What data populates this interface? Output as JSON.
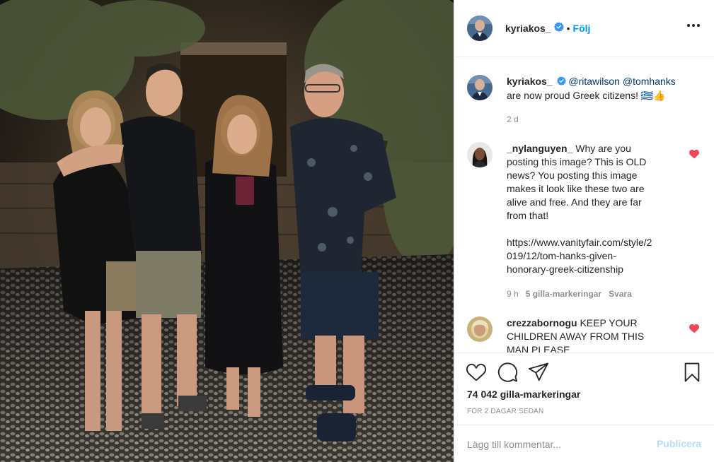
{
  "post": {
    "username": "kyriakos_",
    "follow_label": "Följ",
    "dot": "•"
  },
  "caption": {
    "username": "kyriakos_",
    "mention1": "@ritawilson",
    "mention2": "@tomhanks",
    "text": "are now proud Greek citizens! 🇬🇷👍",
    "flag_text": "GR",
    "time": "2 d"
  },
  "comments": [
    {
      "username": "_nylanguyen_",
      "text_lines": [
        "Why are you",
        "posting this image? This is OLD",
        "news? You posting this image",
        "makes it look like these two are",
        "alive and free. And they are far",
        "from that!"
      ],
      "link_lines": [
        "https://www.vanityfair.com/style/2",
        "019/12/tom-hanks-given-",
        "honorary-greek-citizenship"
      ],
      "time": "9 h",
      "likes_label": "5 gilla-markeringar",
      "reply_label": "Svara"
    },
    {
      "username": "crezzabornogu",
      "text_lines": [
        "KEEP YOUR",
        "CHILDREN AWAY FROM THIS",
        "MAN PLEASE"
      ]
    }
  ],
  "stats": {
    "likes_count": "74 042",
    "likes_label": "gilla-markeringar",
    "date": "FÖR 2 DAGAR SEDAN"
  },
  "add_comment": {
    "placeholder": "Lägg till kommentar...",
    "publish_label": "Publicera"
  },
  "colors": {
    "accent": "#0095f6",
    "link": "#00376b",
    "heart": "#ed4956",
    "muted": "#8e8e8e",
    "publish_disabled": "#b2dffc"
  },
  "icons": [
    "verified-badge-icon",
    "more-options-icon",
    "heart-icon",
    "comment-icon",
    "share-icon",
    "bookmark-icon",
    "small-heart-icon"
  ]
}
